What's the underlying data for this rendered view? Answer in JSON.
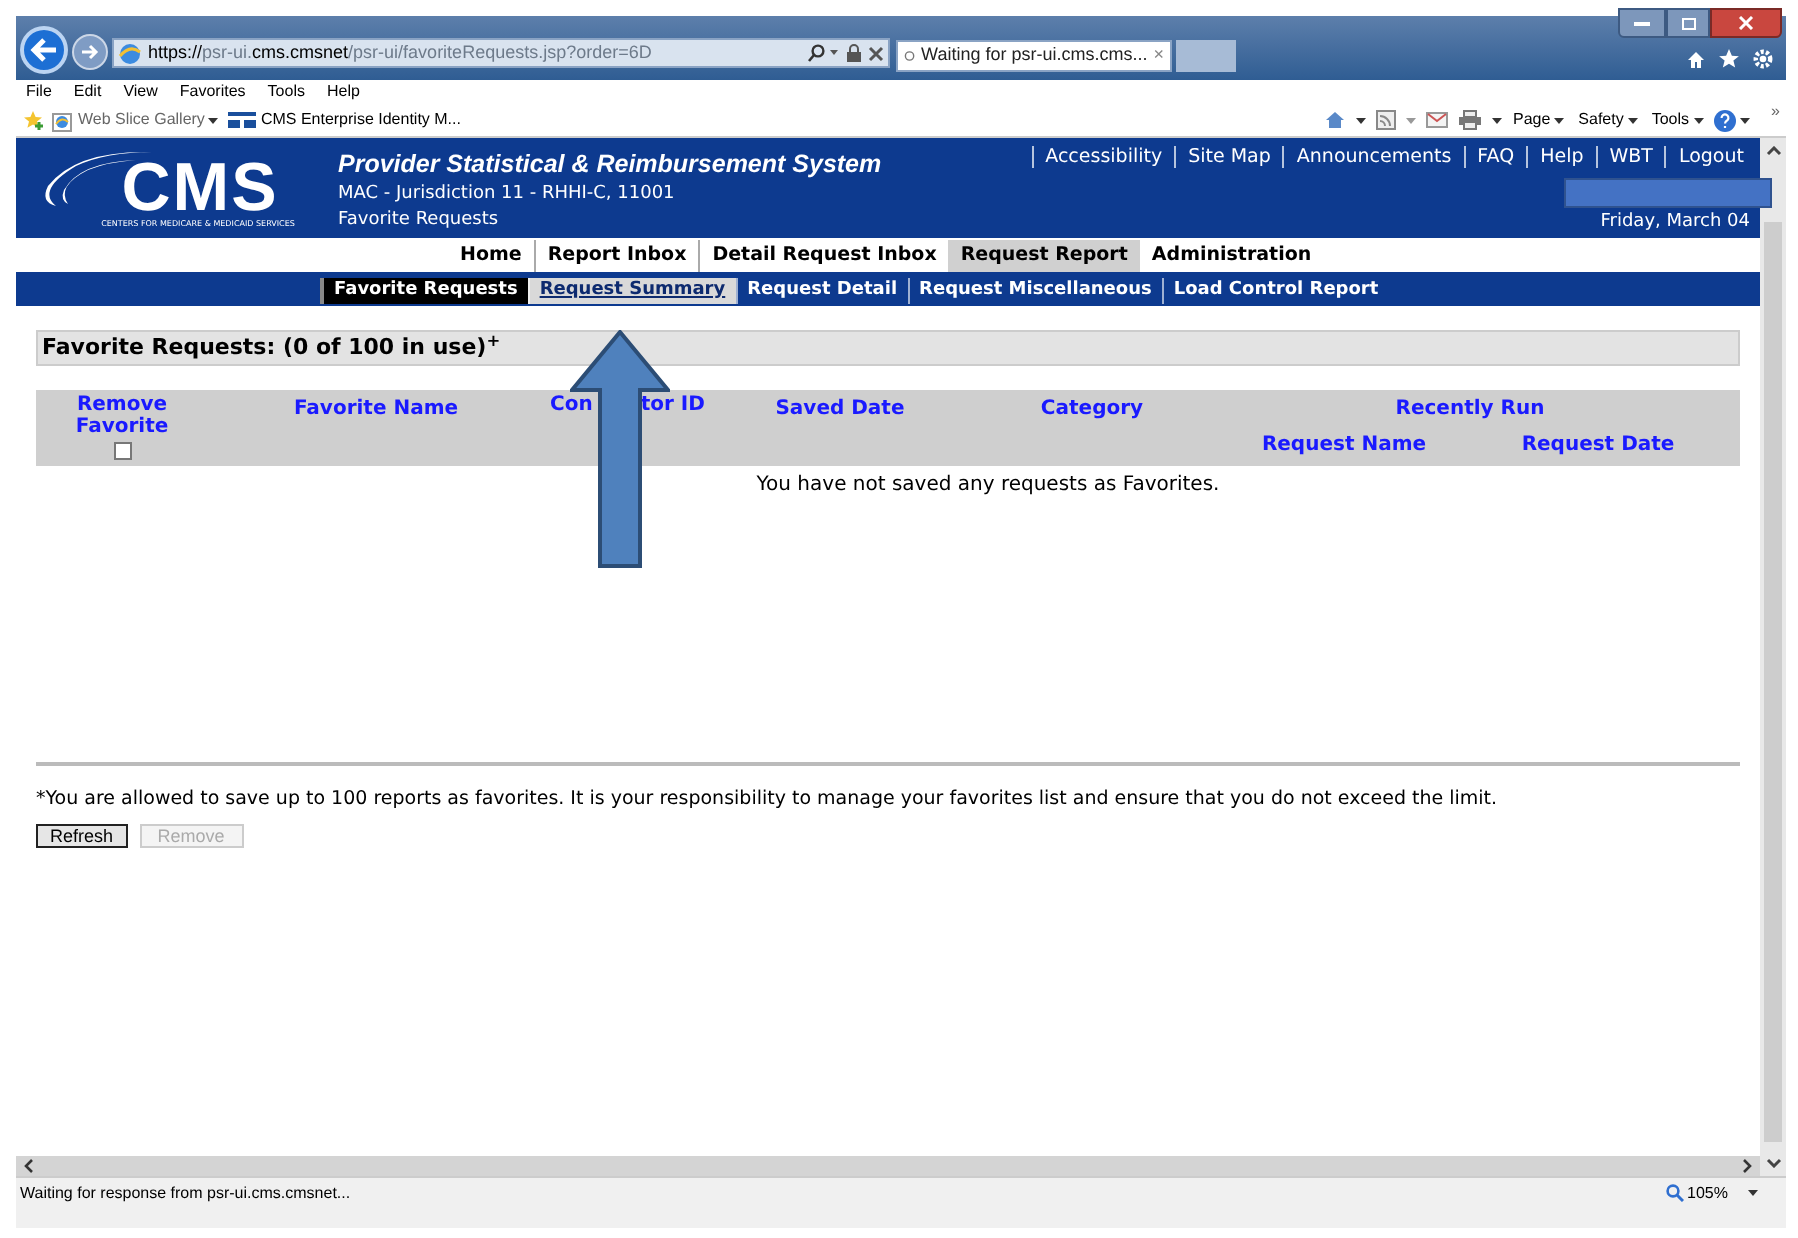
{
  "browser": {
    "address": [
      {
        "text": "https://",
        "strong": true
      },
      {
        "text": "psr-ui.",
        "strong": false
      },
      {
        "text": "cms.cmsnet",
        "strong": true
      },
      {
        "text": "/psr-ui/favoriteRequests.jsp?order=6D",
        "strong": false
      }
    ],
    "tab": {
      "title": "Waiting for psr-ui.cms.cms...",
      "close": "×"
    },
    "menu": [
      "File",
      "Edit",
      "View",
      "Favorites",
      "Tools",
      "Help"
    ],
    "favorites_bar": [
      {
        "label": "Web Slice Gallery",
        "dropdown": true,
        "kind": "slice"
      },
      {
        "label": "CMS Enterprise Identity M...",
        "dropdown": false,
        "kind": "site"
      }
    ],
    "command_bar": [
      {
        "label": "Page",
        "dropdown": true
      },
      {
        "label": "Safety",
        "dropdown": true
      },
      {
        "label": "Tools",
        "dropdown": true
      }
    ],
    "overflow": "»"
  },
  "header": {
    "logo_text": "CMS",
    "logo_tagline": "CENTERS FOR MEDICARE & MEDICAID SERVICES",
    "title": "Provider Statistical & Reimbursement System",
    "subtitle": "MAC - Jurisdiction 11 - RHHI-C, 11001",
    "page_name": "Favorite Requests",
    "date": "Friday, March 04",
    "links": [
      "Accessibility",
      "Site Map",
      "Announcements",
      "FAQ",
      "Help",
      "WBT",
      "Logout"
    ]
  },
  "nav_primary": [
    {
      "label": "Home",
      "selected": false
    },
    {
      "label": "Report Inbox",
      "selected": false
    },
    {
      "label": "Detail Request Inbox",
      "selected": false
    },
    {
      "label": "Request Report",
      "selected": true
    },
    {
      "label": "Administration",
      "selected": false
    }
  ],
  "nav_secondary": [
    {
      "label": "Favorite Requests",
      "selected": true,
      "hovered": false
    },
    {
      "label": "Request Summary",
      "selected": false,
      "hovered": true
    },
    {
      "label": "Request Detail",
      "selected": false,
      "hovered": false
    },
    {
      "label": "Request Miscellaneous",
      "selected": false,
      "hovered": false
    },
    {
      "label": "Load Control Report",
      "selected": false,
      "hovered": false
    }
  ],
  "favorites_panel": {
    "title": "Favorite Requests: (0 of 100 in use)$^{+}$",
    "columns": [
      {
        "label": "Remove Favorite"
      },
      {
        "label": "Favorite Name"
      },
      {
        "label_parts": [
          "Con",
          "tor ID"
        ]
      },
      {
        "label": "Saved Date"
      },
      {
        "label": "Category"
      },
      {
        "label": "Recently Run",
        "sub_columns": [
          "Request Name",
          "Request Date"
        ]
      }
    ],
    "select_all": {
      "checked": false
    },
    "empty_message": "You have not saved any requests as Favorites."
  },
  "footnote": "*You are allowed to save up to 100 reports as favorites. It is your responsibility to manage your favorites list and ensure that you do not exceed the limit.",
  "buttons": [
    {
      "label": "Refresh",
      "disabled": false
    },
    {
      "label": "Remove",
      "disabled": true
    }
  ],
  "status_bar": {
    "text": "Waiting for response from psr-ui.cms.cmsnet...",
    "zoom": "105%"
  }
}
